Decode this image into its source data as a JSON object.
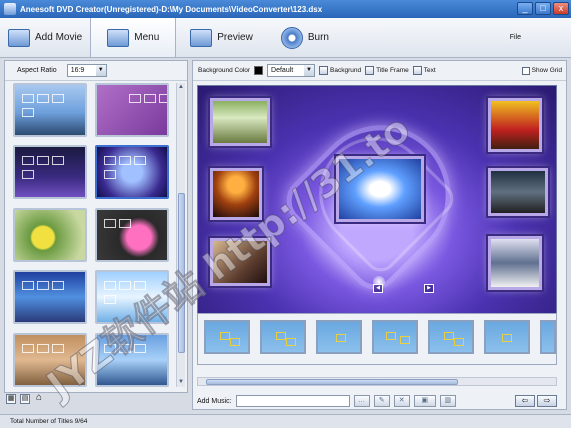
{
  "window": {
    "title": "Aneesoft DVD Creator(Unregistered)-D:\\My Documents\\VideoConverter\\123.dsx",
    "minimize_glyph": "_",
    "maximize_glyph": "□",
    "close_glyph": "x"
  },
  "toolbar": {
    "add_movie": "Add Movie",
    "menu": "Menu",
    "preview": "Preview",
    "burn": "Burn",
    "file": "File"
  },
  "left": {
    "aspect_label": "Aspect Ratio",
    "aspect_value": "16:9",
    "scroll_up": "▲",
    "scroll_down": "▼"
  },
  "menu_options": {
    "bg_color_label": "Background Color",
    "bg_color_value": "Default",
    "background": "Backgrund",
    "title_frame": "Title Frame",
    "text": "Text",
    "show_grid": "Show Grid"
  },
  "music": {
    "label": "Add Music:"
  },
  "status": {
    "total_titles": "Total Number of Titles 9/64"
  },
  "watermark": {
    "text": "JYZ软件站 http://31.to"
  },
  "colors": {
    "accent": "#2a66b8",
    "canvas_bg": "#4a32b0"
  },
  "icons": [
    "add-movie-icon",
    "menu-icon",
    "preview-icon",
    "burn-disc-icon",
    "home-icon",
    "play-icon",
    "stop-icon"
  ]
}
